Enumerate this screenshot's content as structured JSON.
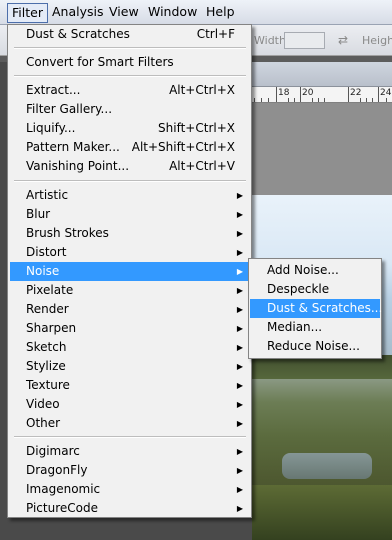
{
  "menubar": {
    "items": [
      "Filter",
      "Analysis",
      "View",
      "Window",
      "Help"
    ]
  },
  "options_bar": {
    "width_label": "Width:",
    "height_label": "Height",
    "width_value": ""
  },
  "ruler": {
    "labels": [
      "18",
      "20",
      "22",
      "24"
    ]
  },
  "filter_menu": {
    "items": [
      {
        "label": "Dust & Scratches",
        "shortcut": "Ctrl+F"
      },
      {
        "label": "Convert for Smart Filters",
        "shortcut": ""
      },
      {
        "label": "Extract...",
        "shortcut": "Alt+Ctrl+X"
      },
      {
        "label": "Filter Gallery...",
        "shortcut": ""
      },
      {
        "label": "Liquify...",
        "shortcut": "Shift+Ctrl+X"
      },
      {
        "label": "Pattern Maker...",
        "shortcut": "Alt+Shift+Ctrl+X"
      },
      {
        "label": "Vanishing Point...",
        "shortcut": "Alt+Ctrl+V"
      },
      {
        "label": "Artistic",
        "submenu": true
      },
      {
        "label": "Blur",
        "submenu": true
      },
      {
        "label": "Brush Strokes",
        "submenu": true
      },
      {
        "label": "Distort",
        "submenu": true
      },
      {
        "label": "Noise",
        "submenu": true,
        "highlighted": true
      },
      {
        "label": "Pixelate",
        "submenu": true
      },
      {
        "label": "Render",
        "submenu": true
      },
      {
        "label": "Sharpen",
        "submenu": true
      },
      {
        "label": "Sketch",
        "submenu": true
      },
      {
        "label": "Stylize",
        "submenu": true
      },
      {
        "label": "Texture",
        "submenu": true
      },
      {
        "label": "Video",
        "submenu": true
      },
      {
        "label": "Other",
        "submenu": true
      },
      {
        "label": "Digimarc",
        "submenu": true
      },
      {
        "label": "DragonFly",
        "submenu": true
      },
      {
        "label": "Imagenomic",
        "submenu": true
      },
      {
        "label": "PictureCode",
        "submenu": true
      }
    ]
  },
  "noise_submenu": {
    "items": [
      {
        "label": "Add Noise..."
      },
      {
        "label": "Despeckle"
      },
      {
        "label": "Dust & Scratches...",
        "highlighted": true
      },
      {
        "label": "Median..."
      },
      {
        "label": "Reduce Noise..."
      }
    ]
  },
  "colors": {
    "highlight": "#3399ff",
    "menu_bg": "#f1f1f1",
    "menu_border": "#848484"
  }
}
